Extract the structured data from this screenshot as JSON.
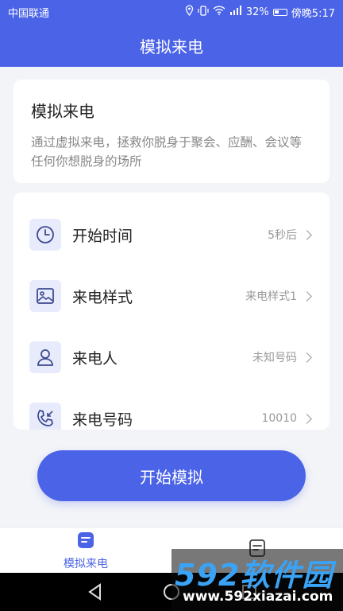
{
  "status_bar": {
    "carrier": "中国联通",
    "battery": "32%",
    "time": "傍晚5:17"
  },
  "header": {
    "title": "模拟来电"
  },
  "intro": {
    "title": "模拟来电",
    "description": "通过虚拟来电，拯救你脱身于聚会、应酬、会议等任何你想脱身的场所"
  },
  "settings": {
    "items": [
      {
        "label": "开始时间",
        "value": "5秒后",
        "icon": "clock-icon"
      },
      {
        "label": "来电样式",
        "value": "来电样式1",
        "icon": "image-icon"
      },
      {
        "label": "来电人",
        "value": "未知号码",
        "icon": "person-icon"
      },
      {
        "label": "来电号码",
        "value": "10010",
        "icon": "phone-incoming-icon"
      }
    ]
  },
  "start_button": {
    "label": "开始模拟"
  },
  "tabs": [
    {
      "label": "模拟来电",
      "active": true,
      "icon": "doc-lines-icon"
    },
    {
      "label": "",
      "active": false,
      "icon": "doc-lines-icon"
    }
  ],
  "watermark": {
    "brand": "592软件园",
    "url": "www.592xiazai.com"
  },
  "colors": {
    "primary": "#4b63e6",
    "icon_bg": "#e8ebfb",
    "text_muted": "#999999"
  }
}
